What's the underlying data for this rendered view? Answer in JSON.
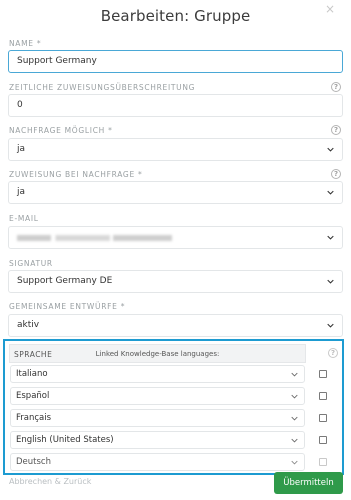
{
  "dialog": {
    "title": "Bearbeiten: Gruppe",
    "close_icon": "×"
  },
  "fields": {
    "name": {
      "label": "Name *",
      "value": "Support Germany"
    },
    "timeout": {
      "label": "Zeitliche Zuweisungsüberschreitung",
      "value": "0"
    },
    "follow_up_possible": {
      "label": "Nachfrage möglich *",
      "value": "ja"
    },
    "assignment_follow_up": {
      "label": "Zuweisung bei Nachfrage *",
      "value": "ja"
    },
    "email": {
      "label": "E-Mail",
      "value": ""
    },
    "signature": {
      "label": "Signatur",
      "value": "Support Germany DE"
    },
    "shared_drafts": {
      "label": "Gemeinsame Entwürfe *",
      "value": "aktiv"
    }
  },
  "knowledge_base": {
    "column_language": "SPRACHE",
    "caption": "Linked Knowledge-Base languages:",
    "languages": [
      {
        "name": "Italiano",
        "checked": false
      },
      {
        "name": "Español",
        "checked": false
      },
      {
        "name": "Français",
        "checked": false
      },
      {
        "name": "English (United States)",
        "checked": false
      },
      {
        "name": "Deutsch",
        "checked": false
      }
    ]
  },
  "actions": {
    "cancel": "Abbrechen & Zurück",
    "submit": "Übermitteln"
  },
  "colors": {
    "accent_border": "#1d9bd1",
    "focus_border": "#4aa8d6",
    "submit_bg": "#2f9a4a"
  },
  "icons": {
    "help": "help-circle-icon",
    "chevron": "chevron-down-icon",
    "close": "close-icon"
  }
}
